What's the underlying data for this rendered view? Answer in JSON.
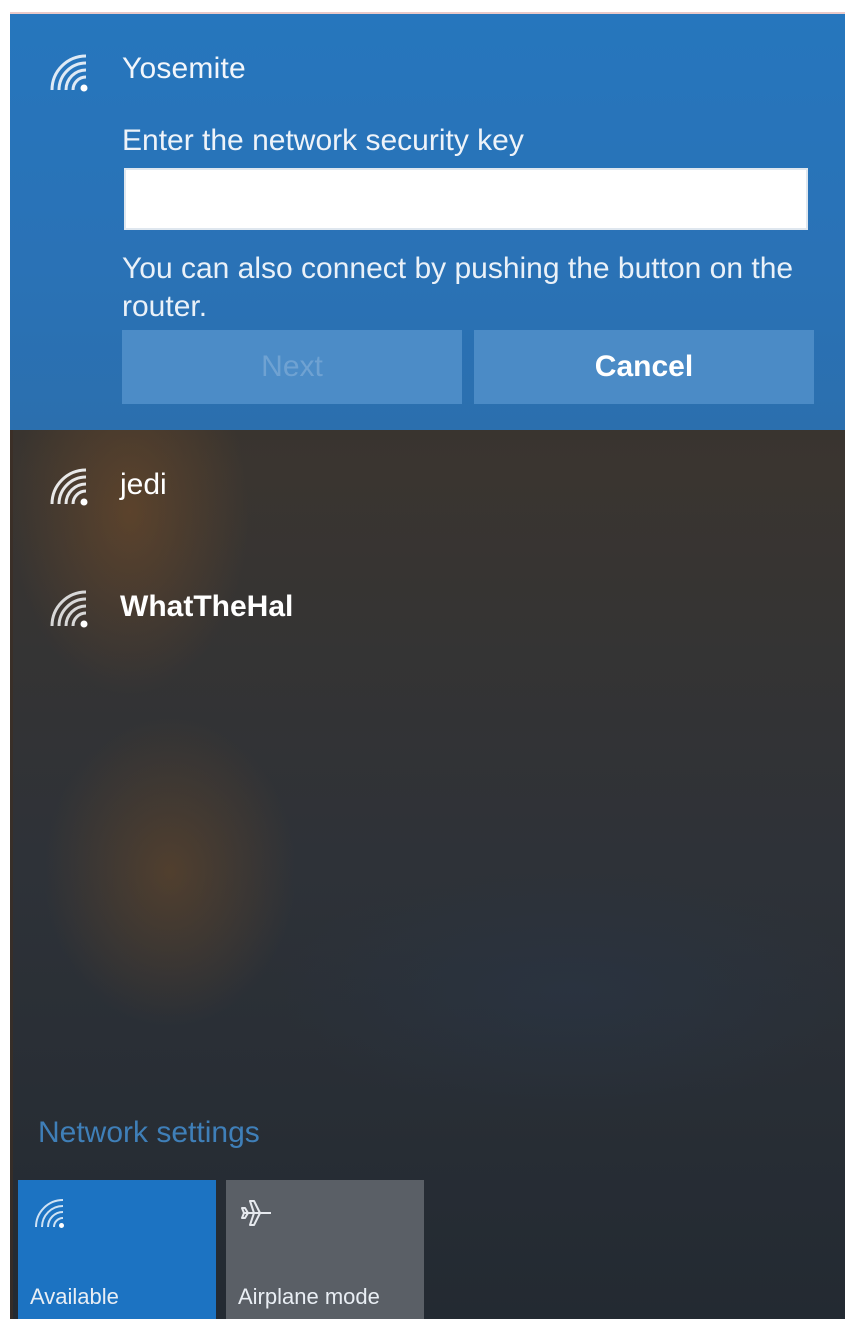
{
  "expanded_network": {
    "name": "Yosemite",
    "icon": "wifi-signal-icon",
    "key_prompt": "Enter the network security key",
    "key_value": "",
    "key_placeholder": "",
    "hint": "You can also connect by pushing the button on the router.",
    "next_label": "Next",
    "cancel_label": "Cancel"
  },
  "networks": [
    {
      "name": "jedi",
      "icon": "wifi-signal-icon",
      "bold": false
    },
    {
      "name": "WhatTheHal",
      "icon": "wifi-signal-icon",
      "bold": true
    }
  ],
  "settings_link": "Network settings",
  "quick_actions": [
    {
      "label": "Available",
      "icon": "wifi-icon",
      "active": true
    },
    {
      "label": "Airplane mode",
      "icon": "airplane-icon",
      "active": false
    }
  ],
  "colors": {
    "accent": "#2676bd",
    "link": "#3f7fb8",
    "tile_active": "#1c73c2",
    "tile_inactive": "#5a5f66"
  }
}
